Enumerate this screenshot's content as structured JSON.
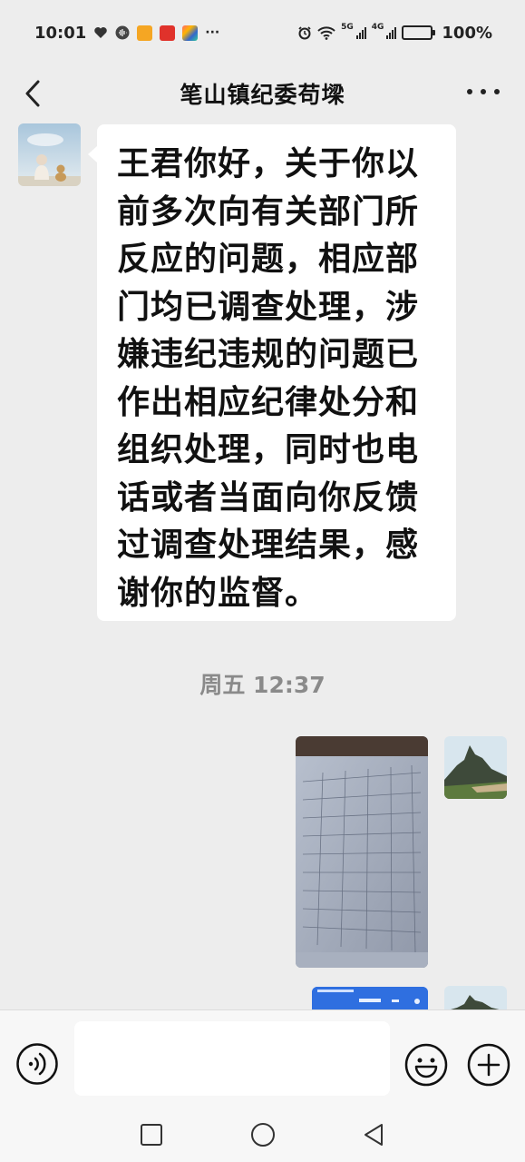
{
  "status_bar": {
    "time": "10:01",
    "signal_1_label": "5G",
    "signal_2_label": "4G",
    "battery": "100%",
    "dots": "···",
    "icons": [
      "heart-icon",
      "voice-app-icon",
      "play-app-icon",
      "news-app-icon",
      "gift-app-icon",
      "alarm-icon",
      "wifi-icon",
      "signal-icon",
      "battery-icon"
    ]
  },
  "header": {
    "title": "笔山镇纪委苟墚",
    "back_icon": "chevron-left-icon",
    "more_icon": "more-dots-icon"
  },
  "messages": [
    {
      "sender": "other",
      "type": "text",
      "text": "王君你好，关于你以前多次向有关部门所反应的问题，相应部门均已调查处理，涉嫌违纪违规的问题已作出相应纪律处分和组织处理，同时也电话或者当面向你反馈过调查处理结果，感谢你的监督。"
    },
    {
      "type": "timestamp",
      "text": "周五 12:37"
    },
    {
      "sender": "me",
      "type": "image",
      "description_icon": "photo-of-document-icon"
    },
    {
      "sender": "me",
      "type": "image",
      "description_icon": "screenshot-thumbnail-icon"
    }
  ],
  "input_bar": {
    "value": "",
    "voice_icon": "voice-icon",
    "emoji_icon": "emoji-icon",
    "plus_icon": "plus-icon"
  },
  "nav_bar": {
    "icons": [
      "recent-apps-icon",
      "home-icon",
      "back-icon"
    ]
  },
  "colors": {
    "background": "#ededed",
    "bubble_other": "#ffffff",
    "timestamp": "#8a8a8a",
    "input_bar": "#f7f7f7"
  }
}
